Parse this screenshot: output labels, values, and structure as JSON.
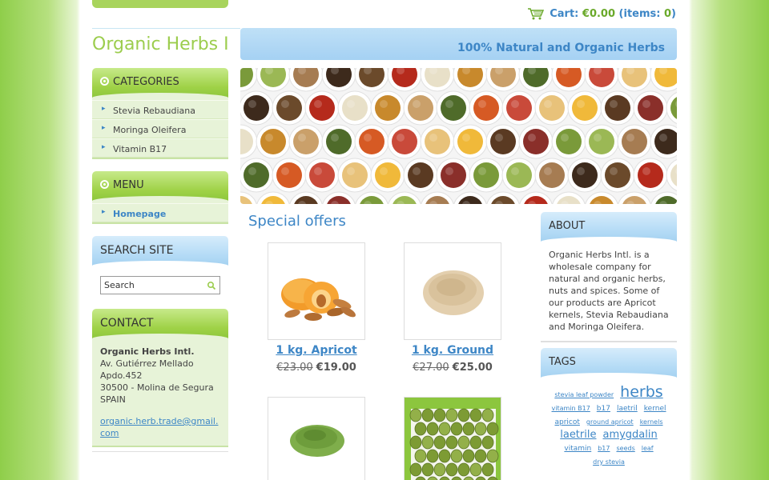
{
  "header": {
    "cart_prefix": "Cart: ",
    "cart_amount": "€0.00",
    "cart_items_prefix": " (items: ",
    "cart_items_count": "0",
    "cart_items_suffix": ")",
    "logo": "Organic Herbs Intl.",
    "slogan": "100% Natural and Organic Herbs"
  },
  "sidebar": {
    "categories_title": "CATEGORIES",
    "categories": [
      {
        "label": "Stevia Rebaudiana"
      },
      {
        "label": "Moringa Oleifera"
      },
      {
        "label": "Vitamin B17"
      }
    ],
    "menu_title": "MENU",
    "menu": [
      {
        "label": "Homepage"
      }
    ],
    "search_title": "SEARCH SITE",
    "search_placeholder": "Search",
    "contact_title": "CONTACT",
    "contact": {
      "name": "Organic Herbs Intl.",
      "address1": "Av. Gutiérrez Mellado",
      "address2": "Apdo.452",
      "address3": "30500 - Molina de Segura",
      "country": "SPAIN",
      "email": "organic.herb.trade@gmail.com"
    }
  },
  "main": {
    "section_title": "Special offers",
    "products": [
      {
        "name": "1 kg. Apricot",
        "old_price": "€23.00",
        "price": "€19.00"
      },
      {
        "name": "1 kg. Ground",
        "old_price": "€27.00",
        "price": "€25.00"
      },
      {
        "name": "",
        "old_price": "",
        "price": ""
      },
      {
        "name": "",
        "old_price": "",
        "price": ""
      }
    ]
  },
  "right": {
    "about_title": "ABOUT",
    "about_text": "Organic Herbs Intl. is a wholesale company for natural and organic herbs, nuts and spices. Some of our products are Apricot kernels, Stevia Rebaudiana and Moringa Oleifera.",
    "tags_title": "TAGS",
    "tags": [
      {
        "label": "stevia leaf powder",
        "size": "t1"
      },
      {
        "label": "herbs",
        "size": "t4"
      },
      {
        "label": "vitamin B17",
        "size": "t1"
      },
      {
        "label": "b17",
        "size": "t2"
      },
      {
        "label": "laetril",
        "size": "t2"
      },
      {
        "label": "kernel",
        "size": "t2"
      },
      {
        "label": "apricot",
        "size": "t2"
      },
      {
        "label": "ground apricot",
        "size": "t1"
      },
      {
        "label": "kernels",
        "size": "t1"
      },
      {
        "label": "laetrile",
        "size": "t3"
      },
      {
        "label": "amygdalin",
        "size": "t3"
      },
      {
        "label": "vitamin",
        "size": "t2"
      },
      {
        "label": "b17",
        "size": "t1"
      },
      {
        "label": "seeds",
        "size": "t1"
      },
      {
        "label": "leaf",
        "size": "t1"
      },
      {
        "label": "dry stevia",
        "size": "t1"
      }
    ]
  },
  "colors": {
    "accent_blue": "#3d86c6",
    "accent_green": "#9ccd4e",
    "sidebar_bg": "#e7f3d8"
  }
}
